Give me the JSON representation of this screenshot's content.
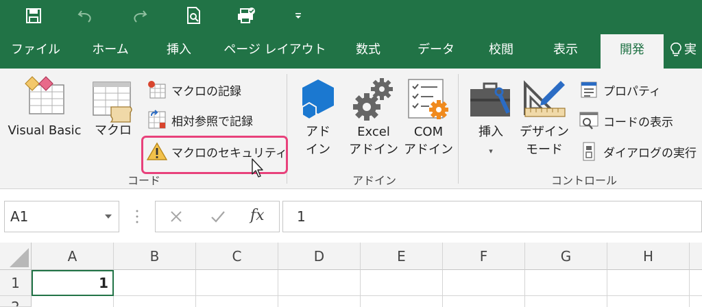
{
  "tabs": [
    {
      "label": "ファイル"
    },
    {
      "label": "ホーム"
    },
    {
      "label": "挿入"
    },
    {
      "label": "ページ レイアウト"
    },
    {
      "label": "数式"
    },
    {
      "label": "データ"
    },
    {
      "label": "校閲"
    },
    {
      "label": "表示"
    },
    {
      "label": "開発",
      "active": true
    },
    {
      "label": "実"
    }
  ],
  "ribbon": {
    "code": {
      "group_label": "コード",
      "visual_basic": "Visual Basic",
      "macros": "マクロ",
      "record_macro": "マクロの記録",
      "relative_ref": "相対参照で記録",
      "macro_security": "マクロのセキュリティ"
    },
    "addins": {
      "group_label": "アドイン",
      "addin_line1": "アド",
      "addin_line2": "イン",
      "excel_line1": "Excel",
      "excel_line2": "アドイン",
      "com_line1": "COM",
      "com_line2": "アドイン"
    },
    "controls": {
      "group_label": "コントロール",
      "insert": "挿入",
      "design_line1": "デザイン",
      "design_line2": "モード",
      "properties": "プロパティ",
      "view_code": "コードの表示",
      "run_dialog": "ダイアログの実行"
    }
  },
  "formula_bar": {
    "name_box": "A1",
    "fx": "fx",
    "formula": "1"
  },
  "grid": {
    "columns": [
      "A",
      "B",
      "C",
      "D",
      "E",
      "F",
      "G",
      "H"
    ],
    "rows": [
      "1",
      "2"
    ],
    "a1_value": "1"
  },
  "colors": {
    "accent": "#217346",
    "highlight": "#e8417b"
  }
}
